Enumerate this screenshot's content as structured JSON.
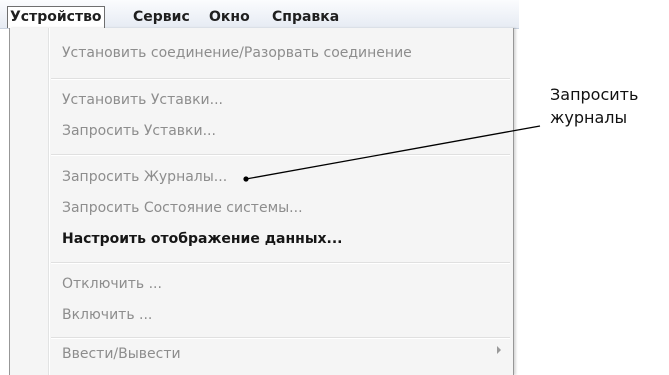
{
  "menubar": {
    "items": [
      {
        "label": "Устройство"
      },
      {
        "label": "Сервис"
      },
      {
        "label": "Окно"
      },
      {
        "label": "Справка"
      }
    ]
  },
  "dropdown": {
    "items": [
      {
        "label": "Установить соединение/Разорвать соединение"
      },
      {
        "label": "Установить Уставки..."
      },
      {
        "label": "Запросить Уставки..."
      },
      {
        "label": "Запросить Журналы..."
      },
      {
        "label": "Запросить Состояние системы..."
      },
      {
        "label": "Настроить отображение данных..."
      },
      {
        "label": "Отключить ..."
      },
      {
        "label": "Включить ..."
      },
      {
        "label": "Ввести/Вывести"
      }
    ]
  },
  "callout": {
    "line1": "Запросить",
    "line2": "журналы"
  },
  "colors": {
    "disabled_text": "#8d8d8d",
    "enabled_text": "#161616",
    "menu_background": "#f5f5f5"
  }
}
